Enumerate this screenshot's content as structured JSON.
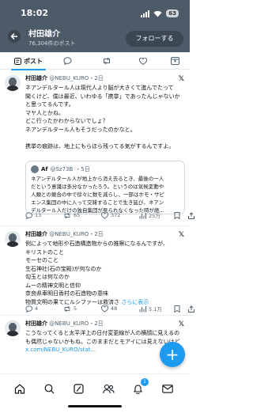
{
  "status": {
    "time": "18:02",
    "battery": "63"
  },
  "header": {
    "title": "村田雄介",
    "subtitle": "76,304件のポスト",
    "follow_label": "フォローする"
  },
  "tabs": {
    "post_label": "ポスト"
  },
  "tweets": [
    {
      "name": "村田雄介",
      "handle": "@NEBU_KURO",
      "time": "・2日",
      "lines": [
        "ネアンデルタール人は現代人より脳が大きくて進んでたって",
        "聞くけど、僕は最近、いわゆる「携挙」であったんじゃないか",
        "と思ってるんです。",
        "マヤ人とかね。",
        "どこ行ったかわからないでしょ？",
        "ネアンデルタール人もそうだったのかなと。",
        "",
        "携挙の痕跡は、地上にもらほら残ってる気がするんですよ。"
      ],
      "quote": {
        "name": "Af",
        "handle": "@Sz73B",
        "time": "・5日",
        "lines": [
          "ネアンデルタール人が地上から消え去るとき、最後の一人",
          "だという意識は多分なかったろう。というのは気候変動や",
          "人類との競合の中で徐々に数を減らし、一部はホモ・サピ",
          "エンス集団の中に入って交雑することで生き延び、ネアン",
          "デルタール人だけの独自集団が見られなくなった時が絶..."
        ]
      },
      "replies": "13",
      "reposts": "65",
      "likes": "372",
      "views": "25万"
    },
    {
      "name": "村田雄介",
      "handle": "@NEBU_KURO",
      "time": "・2日",
      "lines": [
        "例によって地形や石造構造物からの推察になるんですが、",
        "キリストのこと",
        "モーセのこと",
        "生石神社(石の宝殿)が何なのか",
        "勾玉とは何なのか",
        "ムーの精神文明と信仰",
        "奈良県車明日香村の石造物の意味",
        "物質文明の果てにルシファーは救済さ"
      ],
      "more_label": "さらに表示",
      "replies": "4",
      "reposts": "5",
      "likes": "48",
      "views": "5.1万"
    },
    {
      "name": "村田雄介",
      "handle": "@NEBU_KURO",
      "time": "・2日",
      "lines": [
        "こうなってくると太平洋上の日付変更線が人の横顔に見えるの",
        "も偶然じゃないかもね。このままだとモアイには見えないけど"
      ],
      "link": "x.com/NEBU_KURO/stat..."
    }
  ],
  "nav": {
    "notification_count": "1"
  }
}
